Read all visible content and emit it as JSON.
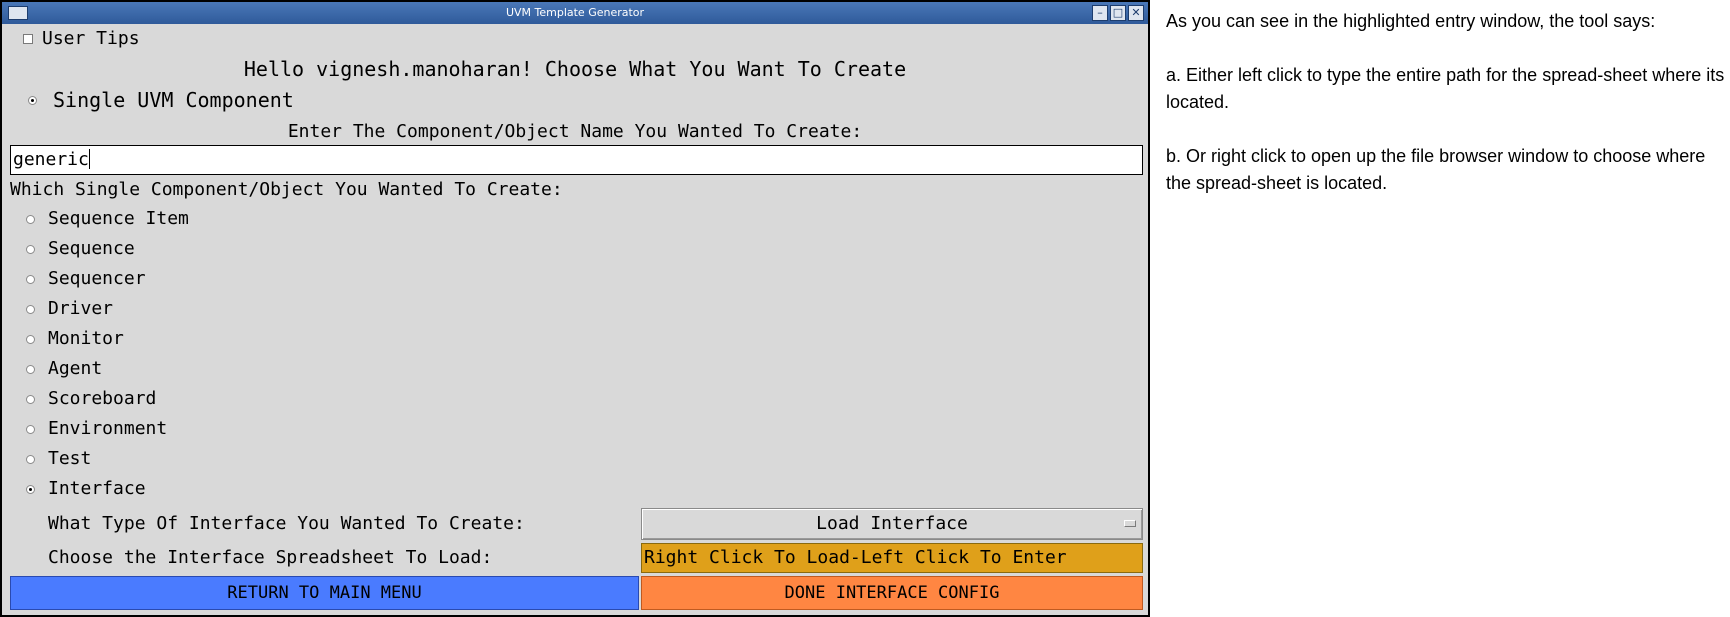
{
  "window": {
    "title": "UVM Template Generator",
    "controls": {
      "minimize": "minimize-icon",
      "maximize": "maximize-icon",
      "close": "close-icon"
    }
  },
  "user_tips": {
    "label": "User Tips",
    "checked": false
  },
  "greeting": "Hello vignesh.manoharan! Choose What You Want To Create",
  "mode": {
    "label": "Single UVM Component",
    "selected": true
  },
  "name_prompt": "Enter The Component/Object Name You Wanted To Create:",
  "name_input": {
    "value": "generic"
  },
  "type_prompt": "Which Single Component/Object You Wanted To Create:",
  "component_options": [
    {
      "label": "Sequence Item",
      "selected": false
    },
    {
      "label": "Sequence",
      "selected": false
    },
    {
      "label": "Sequencer",
      "selected": false
    },
    {
      "label": "Driver",
      "selected": false
    },
    {
      "label": "Monitor",
      "selected": false
    },
    {
      "label": "Agent",
      "selected": false
    },
    {
      "label": "Scoreboard",
      "selected": false
    },
    {
      "label": "Environment",
      "selected": false
    },
    {
      "label": "Test",
      "selected": false
    },
    {
      "label": "Interface",
      "selected": true
    }
  ],
  "interface_type": {
    "label": "What Type Of Interface You Wanted To Create:",
    "value": "Load Interface"
  },
  "spreadsheet": {
    "label": "Choose the Interface Spreadsheet To Load:",
    "button": "Right Click To Load-Left Click To Enter"
  },
  "buttons": {
    "return": "RETURN TO MAIN MENU",
    "done": "DONE INTERFACE CONFIG"
  },
  "colors": {
    "return": "#4a7bff",
    "done": "#ff8642",
    "load": "#dfa01a",
    "window_bg": "#d9d9d9"
  },
  "note": {
    "intro": "As you can see in the highlighted entry window, the tool says:",
    "a": "a. Either left click to type the entire path for the spread-sheet where its located.",
    "b": "b. Or right click to open up the file browser window to choose where the spread-sheet is located."
  }
}
